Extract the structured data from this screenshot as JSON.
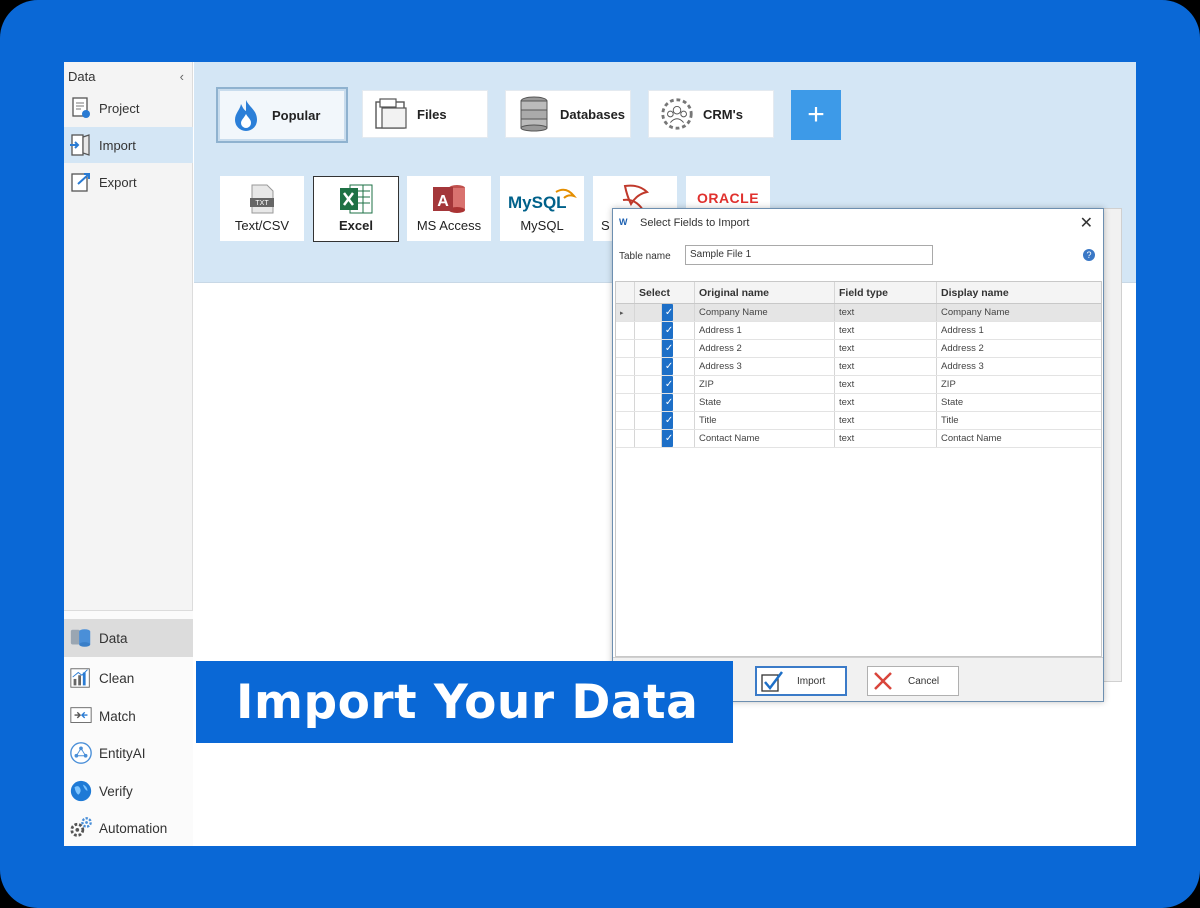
{
  "sidebar": {
    "header": "Data",
    "collapse_icon": "‹",
    "items": [
      {
        "label": "Project",
        "icon": "project-icon"
      },
      {
        "label": "Import",
        "icon": "import-icon"
      },
      {
        "label": "Export",
        "icon": "export-icon"
      }
    ],
    "nav": [
      {
        "label": "Data"
      },
      {
        "label": "Clean"
      },
      {
        "label": "Match"
      },
      {
        "label": "EntityAI"
      },
      {
        "label": "Verify"
      },
      {
        "label": "Automation"
      }
    ]
  },
  "ribbon": {
    "categories": [
      {
        "label": "Popular"
      },
      {
        "label": "Files"
      },
      {
        "label": "Databases"
      },
      {
        "label": "CRM's"
      }
    ],
    "plus_label": "+",
    "sources": [
      {
        "label": "Text/CSV"
      },
      {
        "label": "Excel"
      },
      {
        "label": "MS Access"
      },
      {
        "label": "MySQL"
      },
      {
        "label": "S"
      },
      {
        "label": ""
      }
    ],
    "oracle_logo": "ORACLE",
    "mysql_logo": "MySQL",
    "txt_badge": "TXT"
  },
  "dialog": {
    "title": "Select Fields to Import",
    "logo": "W",
    "close": "✕",
    "table_name_label": "Table name",
    "table_name_value": "Sample File 1",
    "columns": [
      "Select",
      "Original name",
      "Field type",
      "Display name"
    ],
    "rows": [
      {
        "original": "Company Name",
        "type": "text",
        "display": "Company Name",
        "checked": true
      },
      {
        "original": "Address 1",
        "type": "text",
        "display": "Address 1",
        "checked": true
      },
      {
        "original": "Address 2",
        "type": "text",
        "display": "Address 2",
        "checked": true
      },
      {
        "original": "Address 3",
        "type": "text",
        "display": "Address 3",
        "checked": true
      },
      {
        "original": "ZIP",
        "type": "text",
        "display": "ZIP",
        "checked": true
      },
      {
        "original": "State",
        "type": "text",
        "display": "State",
        "checked": true
      },
      {
        "original": "Title",
        "type": "text",
        "display": "Title",
        "checked": true
      },
      {
        "original": "Contact Name",
        "type": "text",
        "display": "Contact Name",
        "checked": true
      }
    ],
    "import_label": "Import",
    "cancel_label": "Cancel"
  },
  "banner": {
    "text": "Import Your Data"
  },
  "colors": {
    "frame": "#0a68d6",
    "ribbon": "#d4e6f5",
    "plus": "#3d9ae8",
    "checkbox": "#1d6fc7"
  }
}
